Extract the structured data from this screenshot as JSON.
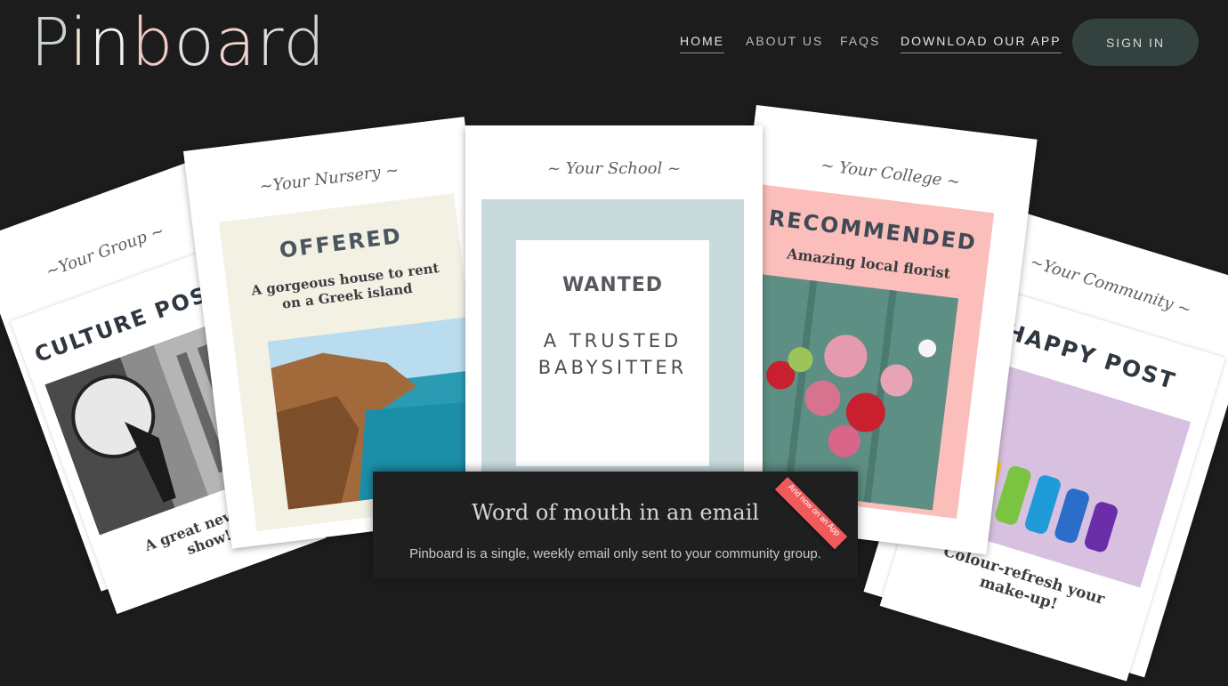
{
  "header": {
    "logo": {
      "text": "Pinboard"
    },
    "nav": [
      {
        "label": "HOME"
      },
      {
        "label": "ABOUT US"
      },
      {
        "label": "FAQS"
      },
      {
        "label": "DOWNLOAD OUR APP"
      }
    ],
    "signin_label": "SIGN IN"
  },
  "cards": {
    "group": {
      "label": "~Your Group ~",
      "heading": "CULTURE POST",
      "caption": "A great new art show!"
    },
    "nursery": {
      "label": "~Your Nursery ~",
      "heading": "OFFERED",
      "caption": "A gorgeous house to rent on a Greek island"
    },
    "school": {
      "label": "~ Your School ~",
      "heading": "WANTED",
      "caption": "A TRUSTED BABYSITTER"
    },
    "college": {
      "label": "~ Your College ~",
      "heading": "RECOMMENDED",
      "caption": "Amazing local florist"
    },
    "community": {
      "label": "~Your Community ~",
      "heading": "HAPPY POST",
      "caption": "Colour-refresh your make-up!"
    }
  },
  "panel": {
    "title": "Word of mouth in an email",
    "text": "Pinboard is a single, weekly email only sent to your community group.",
    "ribbon": "And now on an App"
  },
  "colors": {
    "background": "#1c1c1d",
    "signin": "#33413f",
    "nursery_card": "#f3f0e4",
    "school_card": "#c8dadc",
    "college_card": "#fbbebb",
    "ribbon": "#ef5a5a"
  },
  "icons": [
    "ribbon-banner"
  ]
}
